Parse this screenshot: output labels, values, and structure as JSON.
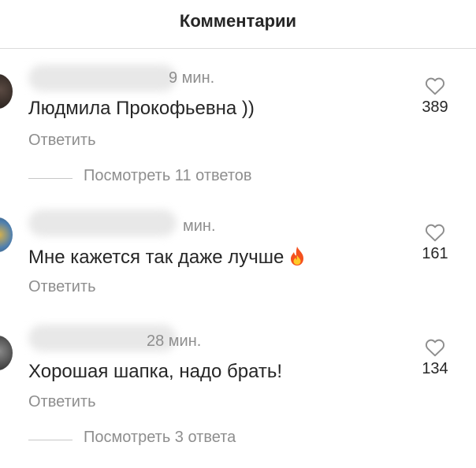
{
  "header": {
    "title": "Комментарии"
  },
  "comments": [
    {
      "time": "9 мин.",
      "text": "Людмила Прокофьевна ))",
      "reply_label": "Ответить",
      "likes": "389",
      "view_replies": "Посмотреть 11 ответов",
      "icon": "heart-outline"
    },
    {
      "time": "мин.",
      "text": "Мне кажется так даже лучше",
      "emoji": "fire",
      "reply_label": "Ответить",
      "likes": "161",
      "icon": "heart-outline"
    },
    {
      "time": "28 мин.",
      "text": "Хорошая шапка, надо брать!",
      "reply_label": "Ответить",
      "likes": "134",
      "view_replies": "Посмотреть 3 ответа",
      "icon": "heart-outline"
    }
  ]
}
